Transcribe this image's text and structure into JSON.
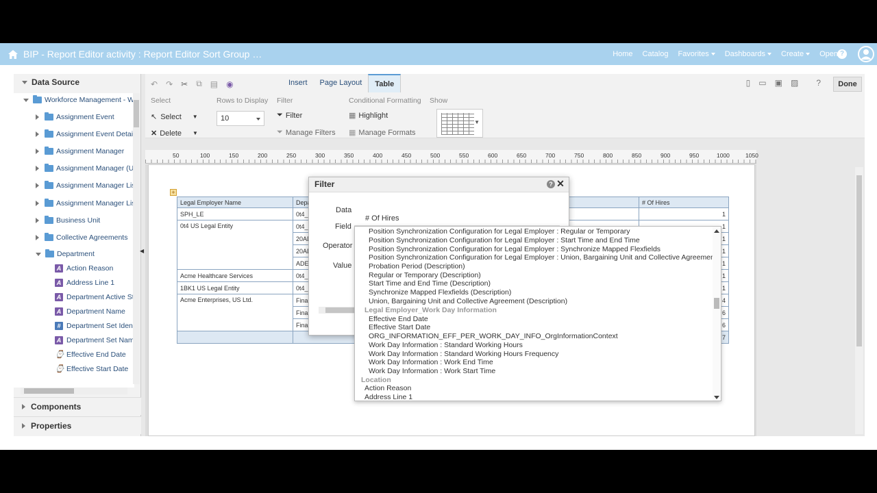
{
  "topbar": {
    "title": "BIP - Report Editor activity : Report Editor Sort Group …",
    "nav": [
      "Home",
      "Catalog",
      "Favorites",
      "Dashboards",
      "Create",
      "Open"
    ]
  },
  "left_panel": {
    "data_source": "Data Source",
    "root": "Workforce Management - W",
    "folders": [
      "Assignment Event",
      "Assignment Event Detail",
      "Assignment Manager",
      "Assignment Manager (U",
      "Assignment Manager Lis",
      "Assignment Manager Lis",
      "Business Unit",
      "Collective Agreements",
      "Department"
    ],
    "fields": [
      {
        "icon": "A",
        "label": "Action Reason"
      },
      {
        "icon": "A",
        "label": "Address Line 1"
      },
      {
        "icon": "A",
        "label": "Department Active St"
      },
      {
        "icon": "A",
        "label": "Department Name"
      },
      {
        "icon": "#",
        "label": "Department Set Iden"
      },
      {
        "icon": "A",
        "label": "Department Set Nam"
      },
      {
        "icon": "date",
        "label": "Effective End Date"
      },
      {
        "icon": "date",
        "label": "Effective Start Date"
      }
    ],
    "components": "Components",
    "properties": "Properties"
  },
  "toolbar": {
    "tabs": [
      "Insert",
      "Page Layout",
      "Table"
    ],
    "done": "Done",
    "select_group": "Select",
    "select_item": "Select",
    "delete_item": "Delete",
    "rows_group": "Rows to Display",
    "rows_value": "10",
    "filter_group": "Filter",
    "filter_item": "Filter",
    "manage_filters": "Manage Filters",
    "cond_group": "Conditional Formatting",
    "highlight": "Highlight",
    "manage_formats": "Manage Formats",
    "show_group": "Show"
  },
  "ruler": [
    "50",
    "100",
    "150",
    "200",
    "250",
    "300",
    "350",
    "400",
    "450",
    "500",
    "550",
    "600",
    "650",
    "700",
    "750",
    "800",
    "850",
    "900",
    "950",
    "1000",
    "1050"
  ],
  "report_table": {
    "headers": [
      "Legal Employer Name",
      "Depa",
      "# Of Hires"
    ],
    "rows": [
      [
        "SPH_LE",
        "0t4_",
        "1"
      ],
      [
        "0t4 US Legal Entity",
        "0t4_",
        "1"
      ],
      [
        "",
        "20AD",
        "1"
      ],
      [
        "",
        "20AD",
        "1"
      ],
      [
        "",
        "ADEF",
        "1"
      ],
      [
        "Acme Healthcare Services",
        "0t4_",
        "1"
      ],
      [
        "1BK1 US Legal Entity",
        "0t4_",
        "1"
      ],
      [
        "Acme Enterprises, US Ltd.",
        "Finar",
        "4"
      ],
      [
        "",
        "Finar",
        "6"
      ],
      [
        "",
        "Finar",
        "6"
      ],
      [
        "",
        "",
        "7"
      ]
    ]
  },
  "filter_dialog": {
    "title": "Filter",
    "data_label": "Data",
    "field_label": "Field",
    "operator_label": "Operator",
    "value_label": "Value",
    "data_value": "# Of Hires"
  },
  "field_dropdown": [
    {
      "type": "item",
      "label": "Position Synchronization Configuration for Legal Employer :  Regular or Temporary"
    },
    {
      "type": "item",
      "label": "Position Synchronization Configuration for Legal Employer :  Start Time and End Time"
    },
    {
      "type": "item",
      "label": "Position Synchronization Configuration for Legal Employer :  Synchronize Mapped Flexfields"
    },
    {
      "type": "item",
      "label": "Position Synchronization Configuration for Legal Employer :  Union, Bargaining Unit and Collective Agreement"
    },
    {
      "type": "item",
      "label": "Probation Period (Description)"
    },
    {
      "type": "item",
      "label": "Regular or Temporary (Description)"
    },
    {
      "type": "item",
      "label": "Start Time and End Time (Description)"
    },
    {
      "type": "item",
      "label": "Synchronize Mapped Flexfields (Description)"
    },
    {
      "type": "item",
      "label": "Union, Bargaining Unit and Collective Agreement (Description)"
    },
    {
      "type": "group1",
      "label": "Legal Employer_Work Day Information"
    },
    {
      "type": "item",
      "label": "Effective End Date"
    },
    {
      "type": "item",
      "label": "Effective Start Date"
    },
    {
      "type": "item",
      "label": "ORG_INFORMATION_EFF_PER_WORK_DAY_INFO_OrgInformationContext"
    },
    {
      "type": "item",
      "label": "Work Day Information :  Standard Working Hours"
    },
    {
      "type": "item",
      "label": "Work Day Information :  Standard Working Hours Frequency"
    },
    {
      "type": "item",
      "label": "Work Day Information :  Work End Time"
    },
    {
      "type": "item",
      "label": "Work Day Information :  Work Start Time"
    },
    {
      "type": "group0",
      "label": "Location"
    },
    {
      "type": "item0",
      "label": "Action Reason"
    },
    {
      "type": "item0",
      "label": "Address Line 1"
    }
  ]
}
